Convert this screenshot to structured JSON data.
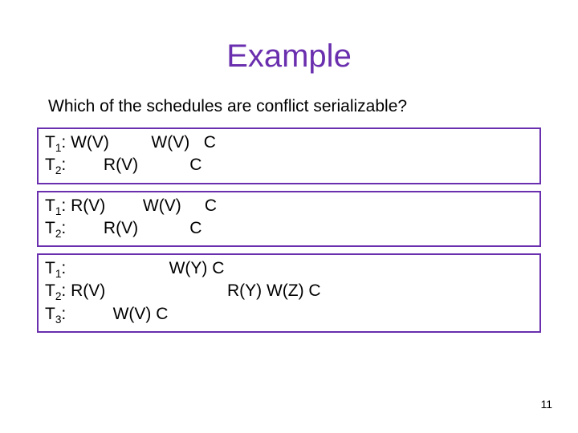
{
  "title": "Example",
  "question": "Which of the schedules are conflict serializable?",
  "boxes": [
    {
      "lines": [
        [
          {
            "t": "T"
          },
          {
            "t": "1",
            "sub": true
          },
          {
            "t": ": W(V)         W(V)   C"
          }
        ],
        [
          {
            "t": "T"
          },
          {
            "t": "2",
            "sub": true
          },
          {
            "t": ":        R(V)           C"
          }
        ]
      ]
    },
    {
      "lines": [
        [
          {
            "t": "T"
          },
          {
            "t": "1",
            "sub": true
          },
          {
            "t": ": R(V)        W(V)     C"
          }
        ],
        [
          {
            "t": "T"
          },
          {
            "t": "2",
            "sub": true
          },
          {
            "t": ":        R(V)           C"
          }
        ]
      ]
    },
    {
      "lines": [
        [
          {
            "t": "T"
          },
          {
            "t": "1",
            "sub": true
          },
          {
            "t": ":                      W(Y) C"
          }
        ],
        [
          {
            "t": "T"
          },
          {
            "t": "2",
            "sub": true
          },
          {
            "t": ": R(V)                          R(Y) W(Z) C"
          }
        ],
        [
          {
            "t": "T"
          },
          {
            "t": "3",
            "sub": true
          },
          {
            "t": ":          W(V) C"
          }
        ]
      ]
    }
  ],
  "pageNumber": "11"
}
